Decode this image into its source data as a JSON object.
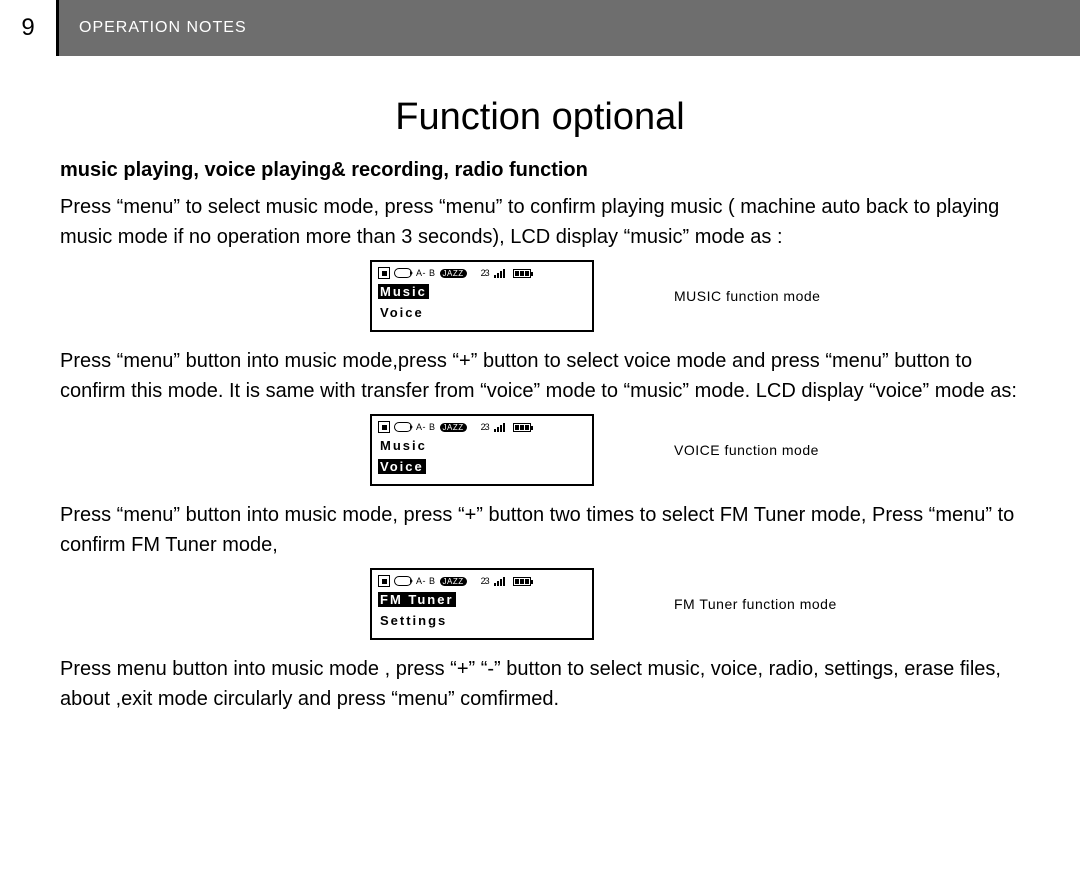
{
  "header": {
    "page_number": "9",
    "section": "OPERATION NOTES"
  },
  "title": "Function optional",
  "subhead": "music playing, voice playing& recording, radio function",
  "para1": "Press “menu” to select music mode, press “menu” to confirm playing music ( machine auto back to playing music mode if no operation more than 3 seconds), LCD display “music” mode as :",
  "para2": "Press “menu” button into music mode,press “+” button to select voice mode and press “menu” button to confirm this mode. It is same with transfer from “voice” mode to “music” mode. LCD display “voice” mode as:",
  "para3": "Press “menu” button into music mode, press “+” button two times to select FM Tuner mode, Press “menu” to confirm FM Tuner mode,",
  "para4": "Press menu button into music mode , press “+” “-” button to select music, voice, radio, settings, erase files, about ,exit  mode circularly and press “menu” comfirmed.",
  "lcd_common": {
    "ab": "A- B",
    "jazz": "JAZZ",
    "num": "23"
  },
  "lcd1": {
    "line1": "Music",
    "line2": "Voice",
    "selected": 1,
    "caption": "MUSIC  function mode"
  },
  "lcd2": {
    "line1": "Music",
    "line2": "Voice",
    "selected": 2,
    "caption": "VOICE  function  mode"
  },
  "lcd3": {
    "line1": "FM Tuner",
    "line2": "Settings",
    "selected": 1,
    "caption": "FM Tuner  function  mode"
  }
}
